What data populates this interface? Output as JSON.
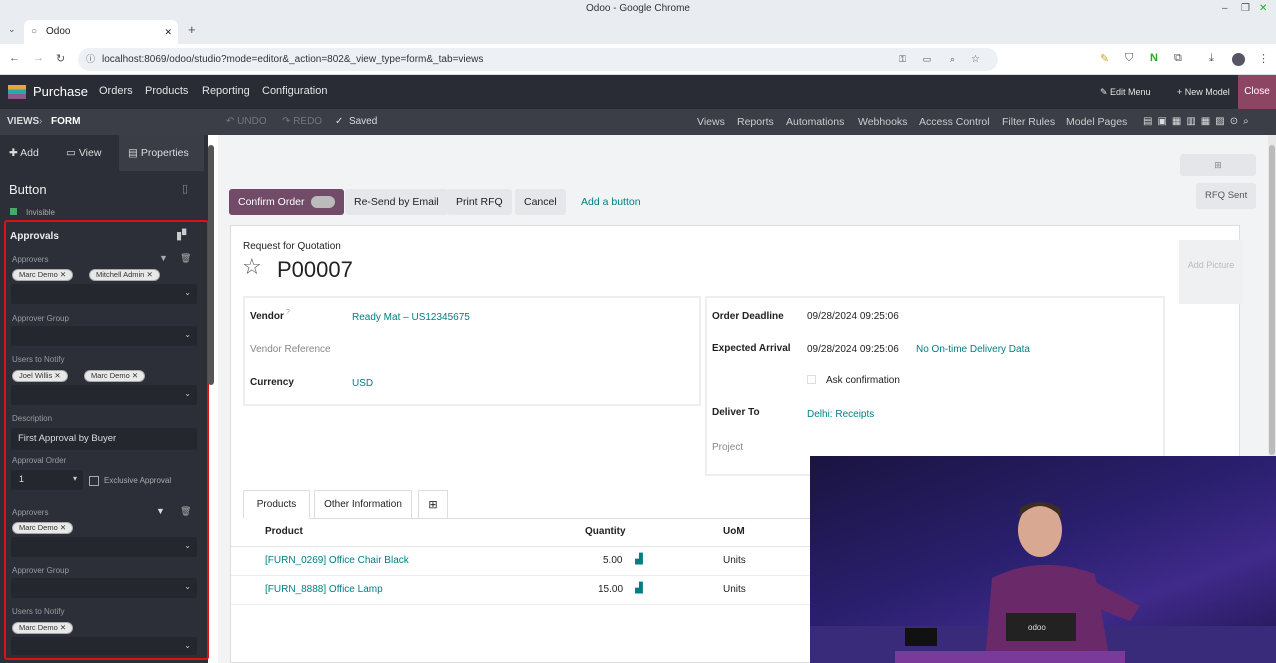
{
  "browser": {
    "window_title": "Odoo - Google Chrome",
    "tab_title": "Odoo",
    "url": "localhost:8069/odoo/studio?mode=editor&_action=802&_view_type=form&_tab=views"
  },
  "nav": {
    "app": "Purchase",
    "menus": [
      "Orders",
      "Products",
      "Reporting",
      "Configuration"
    ],
    "edit_menu": "Edit Menu",
    "new_model": "New Model",
    "close": "Close"
  },
  "studio": {
    "breadcrumb_views": "VIEWS",
    "breadcrumb_form": "FORM",
    "undo": "UNDO",
    "redo": "REDO",
    "saved": "Saved",
    "links": [
      "Views",
      "Reports",
      "Automations",
      "Webhooks",
      "Access Control",
      "Filter Rules",
      "Model Pages"
    ]
  },
  "sidebar": {
    "tabs": {
      "add": "Add",
      "view": "View",
      "properties": "Properties"
    },
    "title": "Button",
    "invisible": "Invisible",
    "approvals": "Approvals",
    "rule1": {
      "approvers_label": "Approvers",
      "approvers": [
        "Marc Demo",
        "Mitchell Admin"
      ],
      "group_label": "Approver Group",
      "notify_label": "Users to Notify",
      "notify": [
        "Joel Willis",
        "Marc Demo"
      ],
      "desc_label": "Description",
      "desc": "First Approval by Buyer",
      "order_label": "Approval Order",
      "order": "1",
      "exclusive": "Exclusive Approval"
    },
    "rule2": {
      "approvers_label": "Approvers",
      "approvers": [
        "Marc Demo"
      ],
      "group_label": "Approver Group",
      "notify_label": "Users to Notify",
      "notify": [
        "Marc Demo"
      ]
    }
  },
  "form": {
    "buttons": {
      "confirm": "Confirm Order",
      "resend": "Re-Send by Email",
      "print": "Print RFQ",
      "cancel": "Cancel",
      "add": "Add a button"
    },
    "status": "RFQ Sent",
    "add_picture": "Add Picture",
    "subtitle": "Request for Quotation",
    "name": "P00007",
    "left": [
      {
        "label": "Vendor",
        "value": "Ready Mat – US12345675"
      },
      {
        "label": "Vendor Reference",
        "value": ""
      },
      {
        "label": "Currency",
        "value": "USD"
      }
    ],
    "right": {
      "deadline_label": "Order Deadline",
      "deadline": "09/28/2024 09:25:06",
      "arrival_label": "Expected Arrival",
      "arrival": "09/28/2024 09:25:06",
      "ontime": "No On-time Delivery Data",
      "ask": "Ask confirmation",
      "deliver_label": "Deliver To",
      "deliver": "Delhi: Receipts",
      "project_label": "Project"
    },
    "tabs": [
      "Products",
      "Other Information"
    ],
    "columns": [
      "Product",
      "Quantity",
      "UoM"
    ],
    "lines": [
      {
        "product": "[FURN_0269] Office Chair Black",
        "qty": "5.00",
        "uom": "Units"
      },
      {
        "product": "[FURN_8888] Office Lamp",
        "qty": "15.00",
        "uom": "Units"
      }
    ]
  },
  "colors": {
    "accent": "#714b67",
    "link": "#017e84",
    "highlight": "#d11111"
  }
}
